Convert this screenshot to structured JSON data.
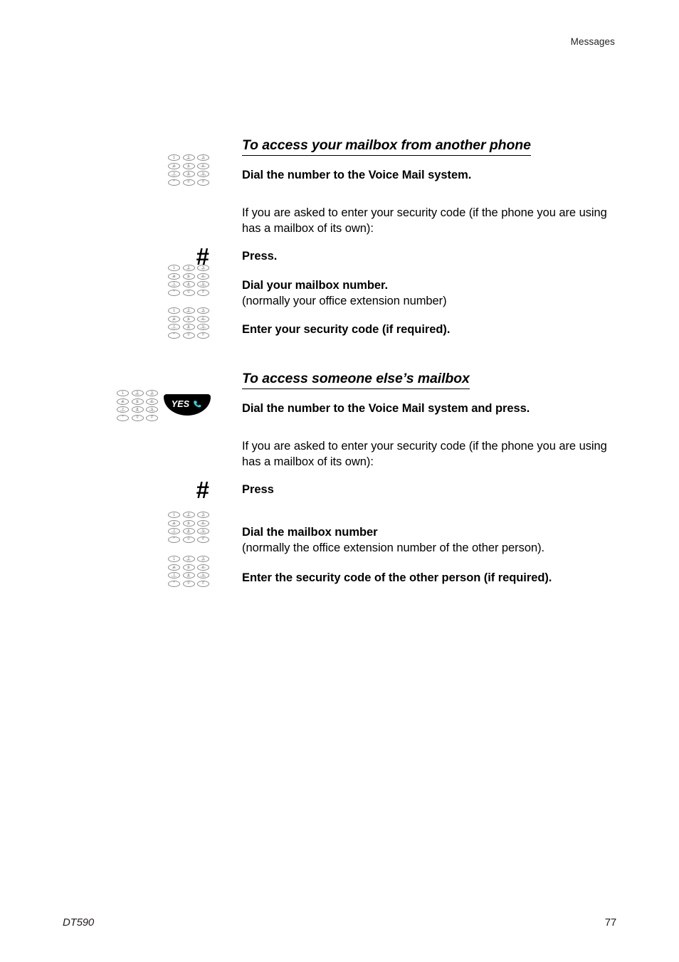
{
  "header": {
    "running_head": "Messages"
  },
  "footer": {
    "document_name": "DT590",
    "page_number": "77"
  },
  "icons": {
    "keypad": "dial-keypad-icon",
    "hash": "#",
    "yes_key_label": "YES",
    "yes_key_glyph": "phone-handset-icon",
    "yes_key_bg_color": "#000000",
    "yes_key_handset_color": "#2ed6e0",
    "yes_key_text_color": "#ffffff"
  },
  "keypad_keys": [
    [
      {
        "num": "1",
        "sub": ""
      },
      {
        "num": "2",
        "sub": "abc"
      },
      {
        "num": "3",
        "sub": "def"
      }
    ],
    [
      {
        "num": "4",
        "sub": "ghi"
      },
      {
        "num": "5",
        "sub": "jkl"
      },
      {
        "num": "6",
        "sub": "mno"
      }
    ],
    [
      {
        "num": "7",
        "sub": "pqrs"
      },
      {
        "num": "8",
        "sub": "tuv"
      },
      {
        "num": "9",
        "sub": "wxyz"
      }
    ],
    [
      {
        "num": "*",
        "sub": ""
      },
      {
        "num": "0",
        "sub": ""
      },
      {
        "num": "#",
        "sub": ""
      }
    ]
  ],
  "sections": [
    {
      "id": "access-own-mailbox",
      "title": "To access your mailbox from another phone",
      "steps": [
        {
          "id": "dial-voice-mail-number",
          "icon": "keypad",
          "lead": "Dial the number to the Voice Mail system.",
          "note": ""
        },
        {
          "id": "security-code-prompt",
          "icon": "none",
          "lead": "",
          "body": "If you are asked to enter your security code (if the phone you are using has a mailbox of its own):"
        },
        {
          "id": "press-hash",
          "icon": "hash",
          "lead": "Press.",
          "note": ""
        },
        {
          "id": "dial-mailbox-number",
          "icon": "keypad",
          "lead": "Dial your mailbox number.",
          "note": "(normally your office extension number)"
        },
        {
          "id": "enter-security-code",
          "icon": "keypad",
          "lead": "Enter your security code (if required).",
          "note": ""
        }
      ]
    },
    {
      "id": "access-other-mailbox",
      "title": "To access someone else’s mailbox",
      "steps": [
        {
          "id": "dial-and-press-yes",
          "icon": "keypad-yes",
          "lead": "Dial the number to the Voice Mail system and press.",
          "note": ""
        },
        {
          "id": "security-code-prompt-2",
          "icon": "none",
          "lead": "",
          "body": "If you are asked to enter your security code (if the phone you are using has a mailbox of its own):"
        },
        {
          "id": "press-hash-2",
          "icon": "hash",
          "lead": "Press",
          "note": ""
        },
        {
          "id": "dial-other-mailbox-number",
          "icon": "keypad",
          "lead": "Dial the mailbox number",
          "note": "(normally the office extension number of the other person)."
        },
        {
          "id": "enter-other-security-code",
          "icon": "keypad",
          "lead": "Enter the security code of the other person (if required).",
          "note": ""
        }
      ]
    }
  ]
}
